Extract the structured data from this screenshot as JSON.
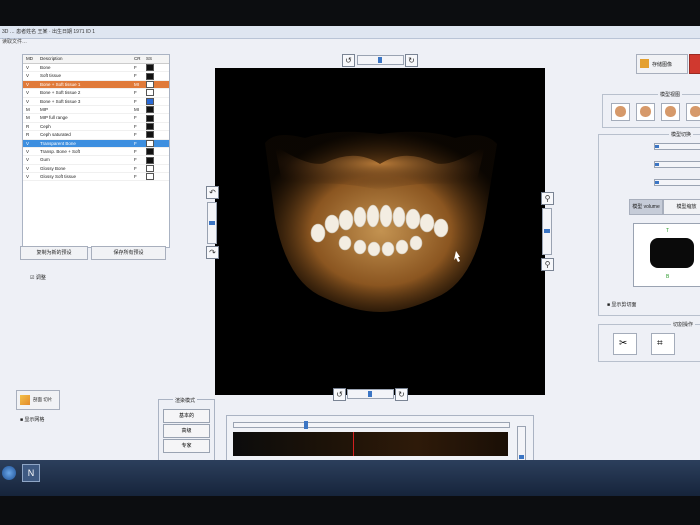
{
  "window": {
    "title": "3D … 患者姓名 王某 · 出生日期 1971 ID 1",
    "subtitle": "读取文件…"
  },
  "presets": {
    "headers": {
      "md": "MD",
      "desc": "Description",
      "cr": "CR",
      "sw": "SS"
    },
    "rows": [
      {
        "md": "V",
        "desc": "Bone",
        "cr": "F",
        "sw": "#111111"
      },
      {
        "md": "V",
        "desc": "Soft tissue",
        "cr": "F",
        "sw": "#111111"
      },
      {
        "md": "V",
        "desc": "Bone + Soft tissue 1",
        "cr": "MI",
        "sw": "#ffffff",
        "state": "orange"
      },
      {
        "md": "V",
        "desc": "Bone + Soft tissue 2",
        "cr": "F",
        "sw": "#ffffff"
      },
      {
        "md": "V",
        "desc": "Bone + Soft tissue 3",
        "cr": "F",
        "sw": "#2a6ad6"
      },
      {
        "md": "M",
        "desc": "MIP",
        "cr": "MI",
        "sw": "#111111"
      },
      {
        "md": "M",
        "desc": "MIP full range",
        "cr": "F",
        "sw": "#111111"
      },
      {
        "md": "R",
        "desc": "Ceph",
        "cr": "F",
        "sw": "#111111"
      },
      {
        "md": "R",
        "desc": "Ceph saturated",
        "cr": "F",
        "sw": "#111111"
      },
      {
        "md": "V",
        "desc": "Transparent Bone",
        "cr": "F",
        "sw": "#ffffff",
        "state": "blue"
      },
      {
        "md": "V",
        "desc": "Transp. Bone + Soft",
        "cr": "F",
        "sw": "#111111"
      },
      {
        "md": "V",
        "desc": "Gum",
        "cr": "F",
        "sw": "#111111"
      },
      {
        "md": "V",
        "desc": "Glossy Bone",
        "cr": "F",
        "sw": "#ffffff"
      },
      {
        "md": "V",
        "desc": "Glossy Soft tissue",
        "cr": "F",
        "sw": "#ffffff"
      }
    ]
  },
  "left_buttons": {
    "copy": "复制为新的预设",
    "save": "保存所有预设",
    "check": "调整"
  },
  "bottom_left": {
    "icon_btn": "剖面 切片",
    "check": "显示网格"
  },
  "render_mode": {
    "title": "渲染模式",
    "modes": [
      "基本的",
      "高级",
      "专家"
    ]
  },
  "right_panel": {
    "save_btn": "存储图像",
    "view_title": "模型视图",
    "adjust_title": "模型切换",
    "volume_tab": "模型 volume",
    "other_tab": "模型缩放",
    "show_label": "显示剪切面",
    "cut_title": "切割操作"
  },
  "colors": {
    "accent": "#3b75c4",
    "orange": "#e07a3a"
  }
}
